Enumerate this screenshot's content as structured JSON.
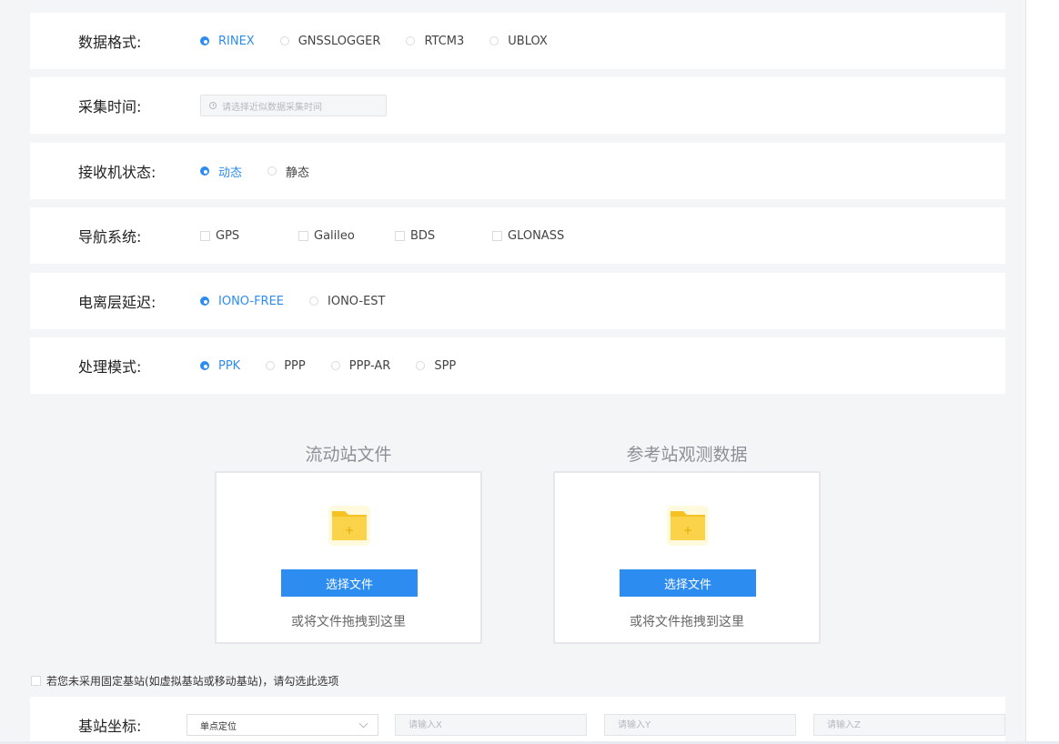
{
  "rows": {
    "format": {
      "label": "数据格式:",
      "options": [
        {
          "label": "RINEX",
          "checked": true
        },
        {
          "label": "GNSSLOGGER",
          "checked": false
        },
        {
          "label": "RTCM3",
          "checked": false
        },
        {
          "label": "UBLOX",
          "checked": false
        }
      ]
    },
    "time": {
      "label": "采集时间:",
      "placeholder": "请选择近似数据采集时间"
    },
    "receiver": {
      "label": "接收机状态:",
      "options": [
        {
          "label": "动态",
          "checked": true
        },
        {
          "label": "静态",
          "checked": false
        }
      ]
    },
    "nav": {
      "label": "导航系统:",
      "options": [
        {
          "label": "GPS",
          "checked": false
        },
        {
          "label": "Galileo",
          "checked": false
        },
        {
          "label": "BDS",
          "checked": false
        },
        {
          "label": "GLONASS",
          "checked": false
        }
      ]
    },
    "iono": {
      "label": "电离层延迟:",
      "options": [
        {
          "label": "IONO-FREE",
          "checked": true
        },
        {
          "label": "IONO-EST",
          "checked": false
        }
      ]
    },
    "mode": {
      "label": "处理模式:",
      "options": [
        {
          "label": "PPK",
          "checked": true
        },
        {
          "label": "PPP",
          "checked": false
        },
        {
          "label": "PPP-AR",
          "checked": false
        },
        {
          "label": "SPP",
          "checked": false
        }
      ]
    }
  },
  "uploads": {
    "rover": {
      "title": "流动站文件",
      "button": "选择文件",
      "hint": "或将文件拖拽到这里"
    },
    "reference": {
      "title": "参考站观测数据",
      "button": "选择文件",
      "hint": "或将文件拖拽到这里"
    }
  },
  "fixed_base": {
    "label": "若您未采用固定基站(如虚拟基站或移动基站)，请勾选此选项",
    "checked": false
  },
  "base_coords": {
    "label": "基站坐标:",
    "select_value": "单点定位",
    "x_placeholder": "请输入X",
    "y_placeholder": "请输入Y",
    "z_placeholder": "请输入Z"
  },
  "colors": {
    "accent": "#2d8cf0",
    "panel": "#f4f5f7"
  }
}
